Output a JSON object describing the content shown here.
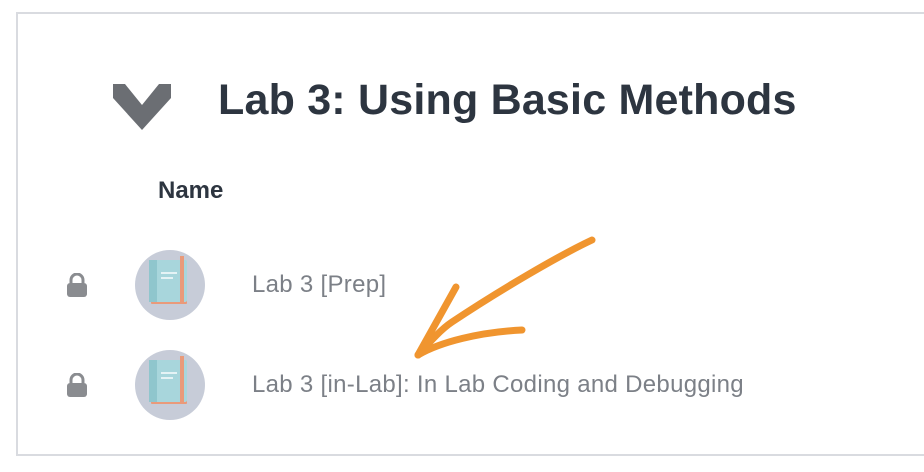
{
  "section": {
    "title": "Lab 3: Using Basic Methods",
    "collapse_icon": "chevron-down-icon"
  },
  "table": {
    "column_name": "Name"
  },
  "items": [
    {
      "label": "Lab 3 [Prep]",
      "lock_icon": "lock-icon",
      "thumbnail_icon": "book-icon"
    },
    {
      "label": "Lab 3 [in-Lab]: In Lab Coding and Debugging",
      "lock_icon": "lock-icon",
      "thumbnail_icon": "book-icon"
    }
  ],
  "annotation": {
    "type": "hand-drawn-arrow",
    "color": "#f0952f"
  },
  "colors": {
    "title_text": "#2d3540",
    "item_text": "#7c8087",
    "border": "#d9dbe0",
    "chevron": "#6b6e73",
    "lock": "#8a8c90",
    "avatar_bg": "#c7ccd8",
    "book_cover": "#a8d6dc",
    "book_accent": "#e99a7a"
  }
}
